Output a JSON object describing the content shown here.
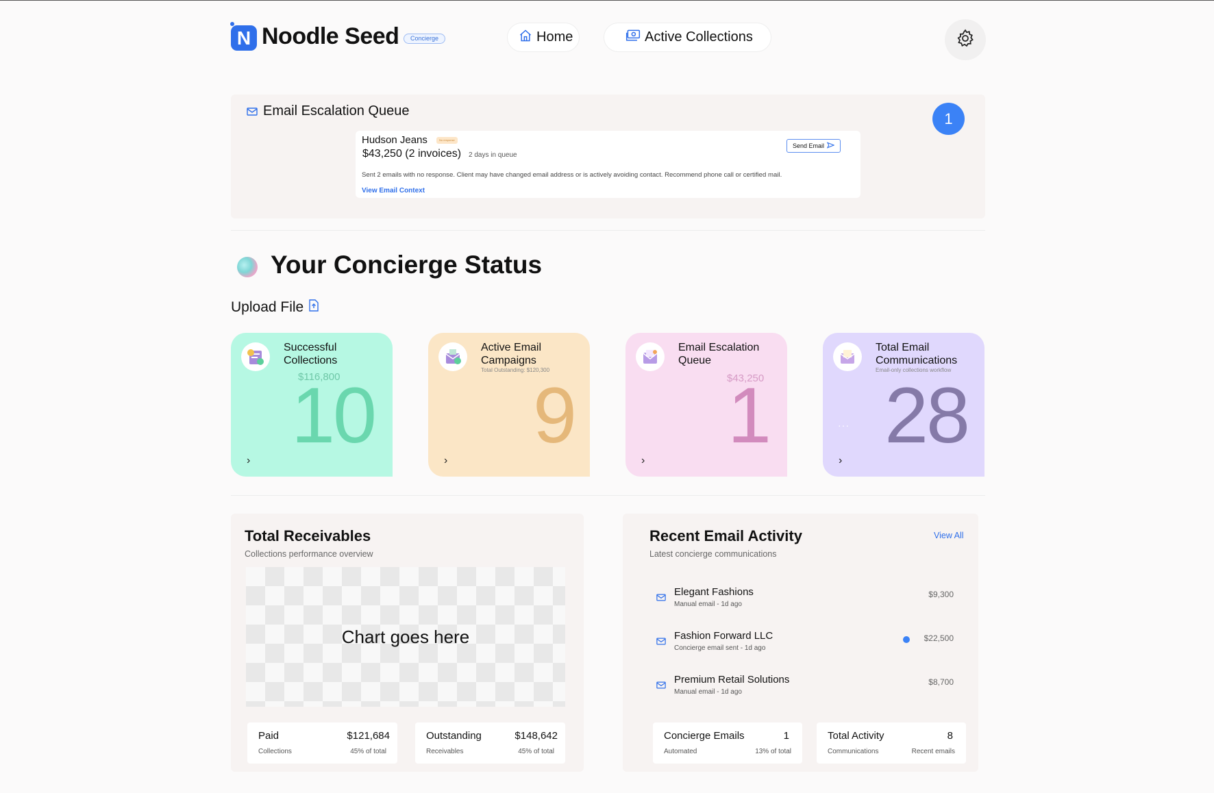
{
  "header": {
    "logo_letter": "N",
    "app_name": "Noodle Seed",
    "badge": "Concierge",
    "nav": [
      {
        "label": "Home",
        "icon": "home-icon"
      },
      {
        "label": "Active Collections",
        "icon": "money-icon"
      }
    ],
    "settings_icon": "gear-icon"
  },
  "escalation": {
    "title": "Email Escalation Queue",
    "count": "1",
    "item": {
      "client": "Hudson Jeans",
      "badge": "No response",
      "amount": "$43,250 (2 invoices)",
      "days": "2 days in queue",
      "send_label": "Send Email",
      "description": "Sent 2 emails with no response. Client may have changed email address or is actively avoiding contact. Recommend phone call or certified mail.",
      "link": "View Email Context"
    }
  },
  "status": {
    "title": "Your Concierge Status",
    "upload_label": "Upload File",
    "cards": [
      {
        "title": "Successful Collections",
        "subtitle": "",
        "money": "$116,800",
        "value": "10",
        "color": "#6ad7ae"
      },
      {
        "title": "Active Email Campaigns",
        "subtitle": "Total Outstanding: $120,300",
        "money": "",
        "value": "9",
        "color": "#e5b87a"
      },
      {
        "title": "Email Escalation Queue",
        "subtitle": "",
        "money": "$43,250",
        "value": "1",
        "color": "#d28bbd"
      },
      {
        "title": "Total Email Communications",
        "subtitle": "Email-only collections workflow",
        "money": "",
        "value": "28",
        "color": "#857aa8"
      }
    ]
  },
  "receivables": {
    "title": "Total Receivables",
    "subtitle": "Collections performance overview",
    "chart_placeholder": "Chart goes here",
    "paid": {
      "label": "Paid",
      "value": "$121,684",
      "foot_left": "Collections",
      "foot_right": "45% of total"
    },
    "outstanding": {
      "label": "Outstanding",
      "value": "$148,642",
      "foot_left": "Receivables",
      "foot_right": "45% of total"
    }
  },
  "activity": {
    "title": "Recent Email Activity",
    "subtitle": "Latest concierge communications",
    "view_all": "View All",
    "items": [
      {
        "name": "Elegant Fashions",
        "meta": "Manual email - 1d ago",
        "amount": "$9,300"
      },
      {
        "name": "Fashion Forward LLC",
        "meta": "Concierge email sent - 1d ago",
        "amount": "$22,500"
      },
      {
        "name": "Premium Retail Solutions",
        "meta": "Manual email - 1d ago",
        "amount": "$8,700"
      }
    ],
    "concierge": {
      "label": "Concierge Emails",
      "value": "1",
      "foot_left": "Automated",
      "foot_right": "13% of total"
    },
    "total": {
      "label": "Total Activity",
      "value": "8",
      "foot_left": "Communications",
      "foot_right": "Recent emails"
    }
  }
}
